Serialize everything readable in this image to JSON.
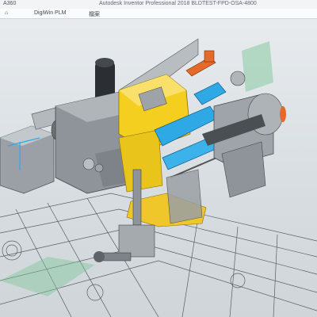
{
  "window": {
    "app_label": "A360",
    "title": "Autodesk Inventor Professional 2018   BLDTEST-FPD-OSA-4800"
  },
  "tabs": [
    {
      "label": "DigiWin PLM"
    },
    {
      "label": "檔案"
    }
  ],
  "colors": {
    "yellow": "#f4cf1f",
    "blue": "#2fa8e6",
    "gray": "#8e9499",
    "dark": "#2b2f33",
    "orange": "#e46a2c",
    "green": "#7fc89a"
  }
}
